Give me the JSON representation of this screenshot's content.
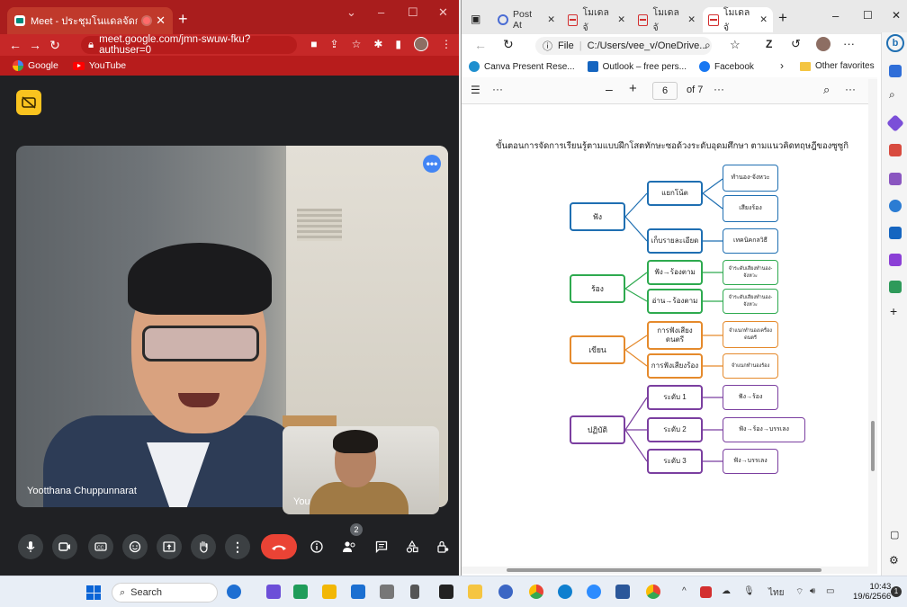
{
  "chrome": {
    "tab_title": "Meet - ประชุมโนแดลจัดการเรียน",
    "new_tab": "+",
    "address": "meet.google.com/jmn-swuw-fku?authuser=0",
    "bookmarks": [
      "Google",
      "YouTube"
    ],
    "window_controls": [
      "⌄",
      "–",
      "☐",
      "✕"
    ]
  },
  "meet": {
    "main_participant": "Yootthana Chuppunnarat",
    "self_label": "You",
    "people_count": "2",
    "accent_colors": {
      "hangup": "#ea4335",
      "badge": "#f9c31f",
      "more": "#4285f4"
    }
  },
  "edge": {
    "tabs": [
      {
        "label": "Post At"
      },
      {
        "label": "โมเดลจั"
      },
      {
        "label": "โมเดลจั"
      },
      {
        "label": "โมเดลจั"
      }
    ],
    "address_prefix": "File",
    "address": "C:/Users/vee_v/OneDrive...",
    "profile_letter": "Z",
    "bookmarks": [
      "Canva Present Rese...",
      "Outlook – free pers...",
      "Facebook"
    ],
    "other_favorites": "Other favorites",
    "pdf": {
      "page": "6",
      "of_pages": "of 7",
      "zoom_out": "–",
      "zoom_in": "+"
    }
  },
  "document": {
    "heading": "ขั้นตอนการจัดการเรียนรู้ตามแบบฝึกโสตทักษะซอด้วงระดับอุดมศึกษา ตามแนวคิดทฤษฎีของซูซูกิ",
    "mindmap": {
      "roots": [
        "ฟัง",
        "ร้อง",
        "เขียน",
        "ปฏิบัติ"
      ],
      "mids": [
        "แยกโน้ต",
        "เก็บรายละเอียด",
        "ฟัง→ร้องตาม",
        "อ่าน→ร้องตาม",
        "การฟังเสียงดนตรี",
        "การฟังเสียงร้อง",
        "ระดับ 1",
        "ระดับ 2",
        "ระดับ 3"
      ],
      "leaves": [
        "ทำนอง-จังหวะ",
        "เสียงร้อง",
        "เทคนิคกลวิธี",
        "จำระดับเสียงทำนอง-จังหวะ",
        "จำระดับเสียงทำนอง-จังหวะ",
        "จำแนกทำนองเครื่องดนตรี",
        "จำแนกทำนองร้อง",
        "ฟัง→ร้อง",
        "ฟัง→ร้อง→บรรเลง",
        "ฟัง→บรรเลง"
      ],
      "colors": {
        "blue": "#1f6fb2",
        "green": "#2eaa4f",
        "orange": "#e58a2c",
        "purple": "#7b3fa0"
      }
    }
  },
  "taskbar": {
    "search_placeholder": "Search",
    "lang": "ไทย",
    "time": "10:43",
    "date": "19/6/2566"
  }
}
